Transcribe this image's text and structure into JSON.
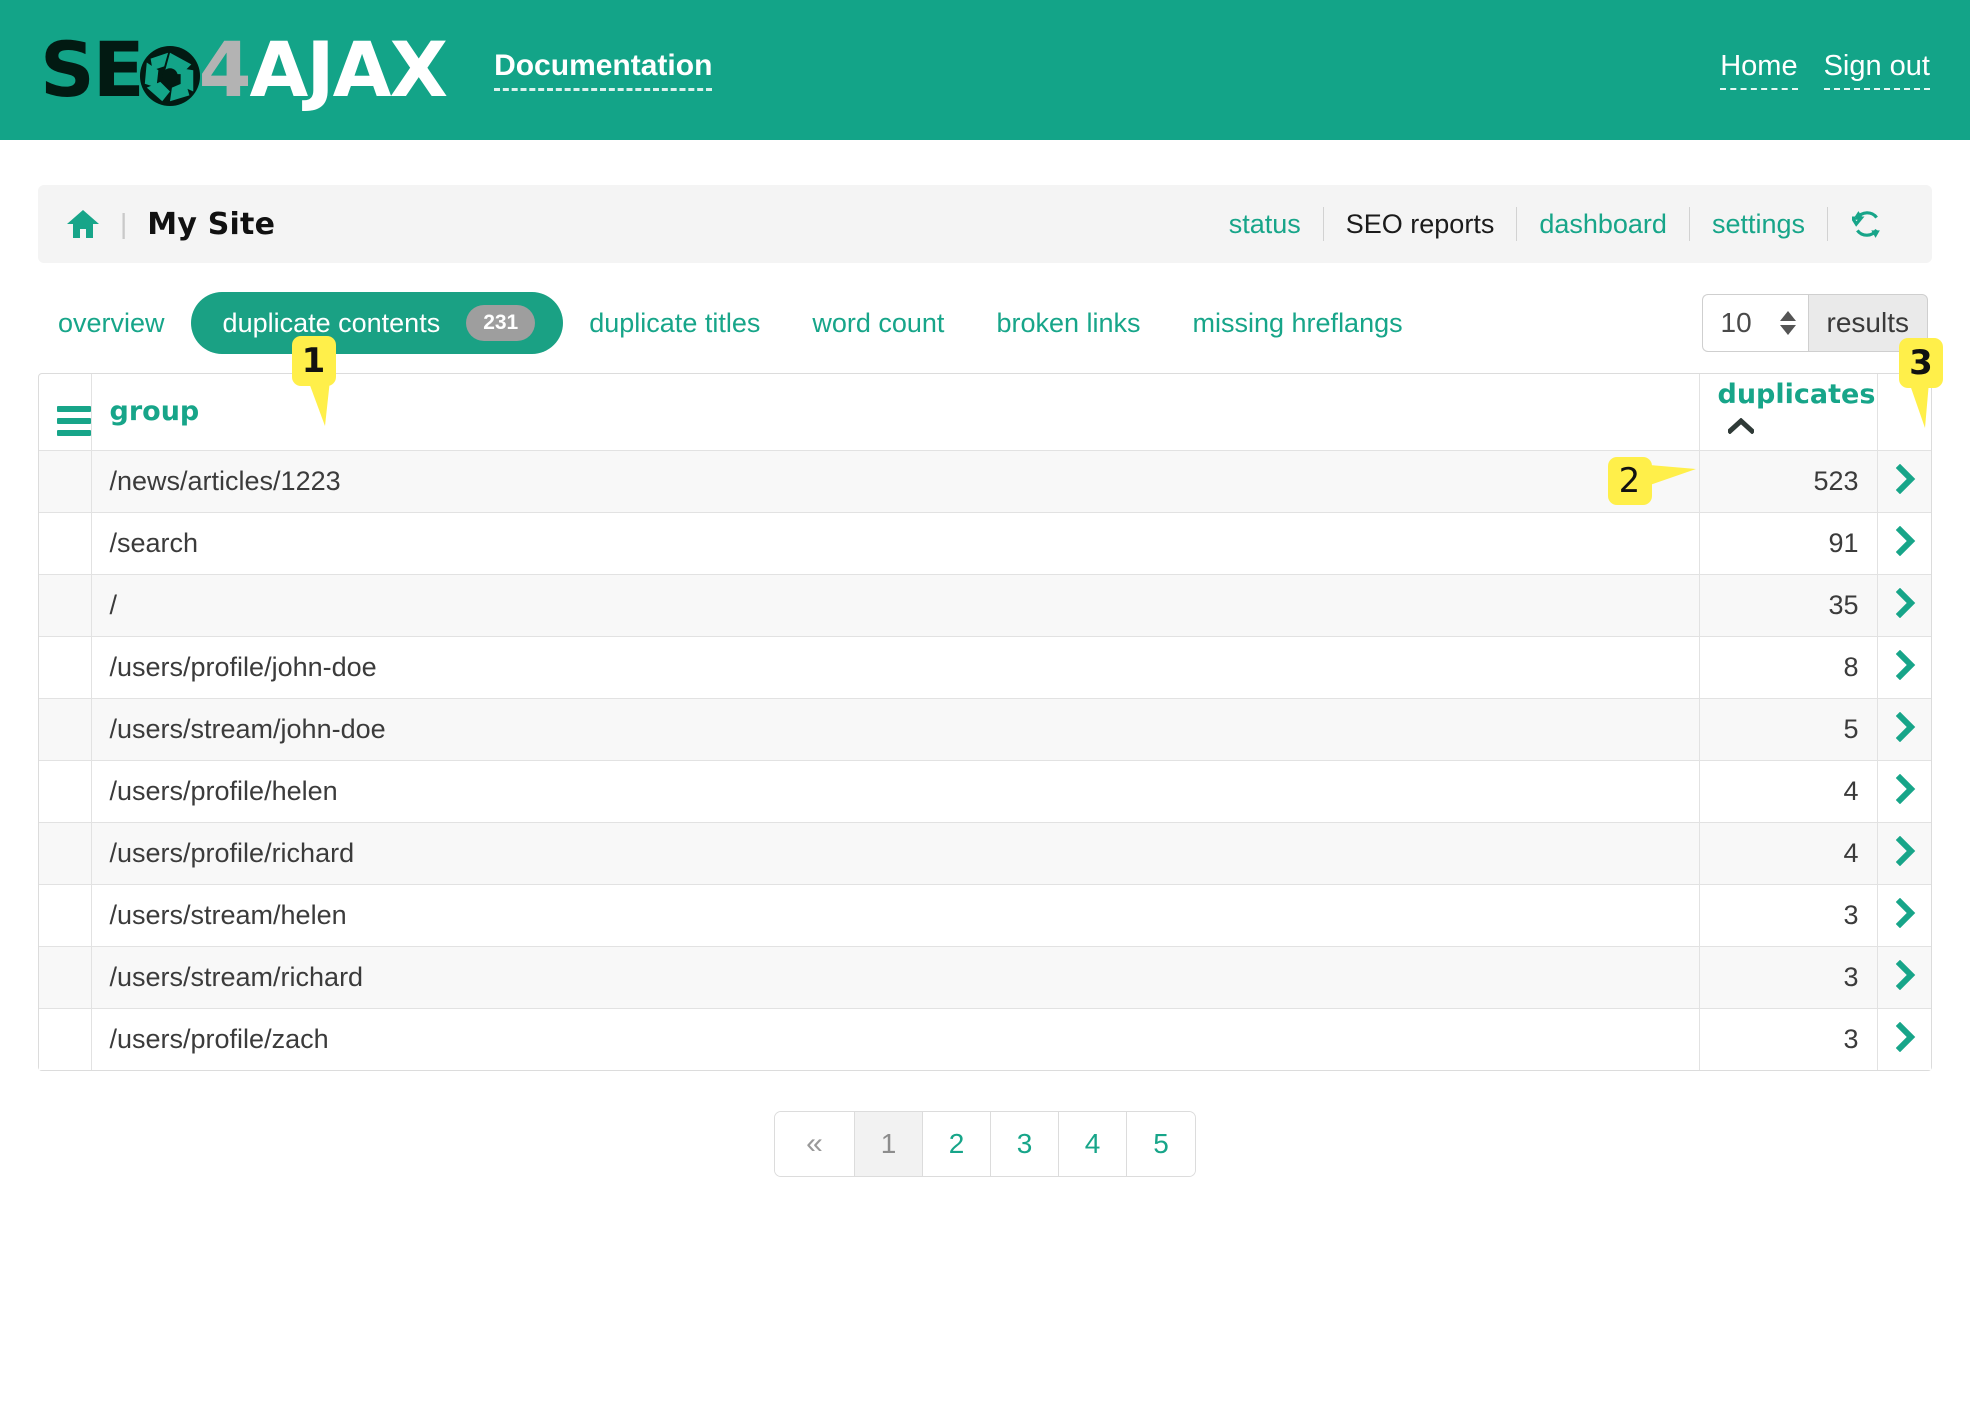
{
  "header": {
    "logo": {
      "part_dark": "SE",
      "part_o_icon": "aperture-icon",
      "part_gray": "4",
      "part_white": "AJAX"
    },
    "doc_link": "Documentation",
    "nav": [
      {
        "label": "Home"
      },
      {
        "label": "Sign out"
      }
    ]
  },
  "site_toolbar": {
    "home_icon": "home-icon",
    "separator": "|",
    "site_name": "My Site",
    "links": [
      {
        "label": "status",
        "active": false
      },
      {
        "label": "SEO reports",
        "active": true
      },
      {
        "label": "dashboard",
        "active": false
      },
      {
        "label": "settings",
        "active": false
      }
    ],
    "refresh_icon": "refresh-icon"
  },
  "tabs": [
    {
      "label": "overview",
      "active": false,
      "badge": null
    },
    {
      "label": "duplicate contents",
      "active": true,
      "badge": "231"
    },
    {
      "label": "duplicate titles",
      "active": false,
      "badge": null
    },
    {
      "label": "word count",
      "active": false,
      "badge": null
    },
    {
      "label": "broken links",
      "active": false,
      "badge": null
    },
    {
      "label": "missing hreflangs",
      "active": false,
      "badge": null
    }
  ],
  "results_selector": {
    "value": "10",
    "label": "results",
    "spinner_icon": "spinner-arrows-icon"
  },
  "table": {
    "menu_icon": "hamburger-menu-icon",
    "columns": {
      "group": "group",
      "duplicates": "duplicates",
      "sort_icon": "caret-up-icon",
      "row_arrow_icon": "chevron-right-icon"
    },
    "rows": [
      {
        "group": "/news/articles/1223",
        "duplicates": "523"
      },
      {
        "group": "/search",
        "duplicates": "91"
      },
      {
        "group": "/",
        "duplicates": "35"
      },
      {
        "group": "/users/profile/john-doe",
        "duplicates": "8"
      },
      {
        "group": "/users/stream/john-doe",
        "duplicates": "5"
      },
      {
        "group": "/users/profile/helen",
        "duplicates": "4"
      },
      {
        "group": "/users/profile/richard",
        "duplicates": "4"
      },
      {
        "group": "/users/stream/helen",
        "duplicates": "3"
      },
      {
        "group": "/users/stream/richard",
        "duplicates": "3"
      },
      {
        "group": "/users/profile/zach",
        "duplicates": "3"
      }
    ]
  },
  "callouts": [
    {
      "number": "1",
      "target": "group-column-header"
    },
    {
      "number": "2",
      "target": "duplicates-cell-first-row"
    },
    {
      "number": "3",
      "target": "row-detail-arrow"
    }
  ],
  "pagination": {
    "prev_label": "«",
    "pages": [
      {
        "label": "1",
        "current": true
      },
      {
        "label": "2",
        "current": false
      },
      {
        "label": "3",
        "current": false
      },
      {
        "label": "4",
        "current": false
      },
      {
        "label": "5",
        "current": false
      }
    ]
  },
  "colors": {
    "brand_teal": "#13a488",
    "link_teal": "#17a589",
    "tab_active": "#1aa184",
    "badge_gray": "#9e9e9e",
    "callout_yellow": "#ffef4a",
    "toolbar_gray": "#f4f4f4"
  }
}
